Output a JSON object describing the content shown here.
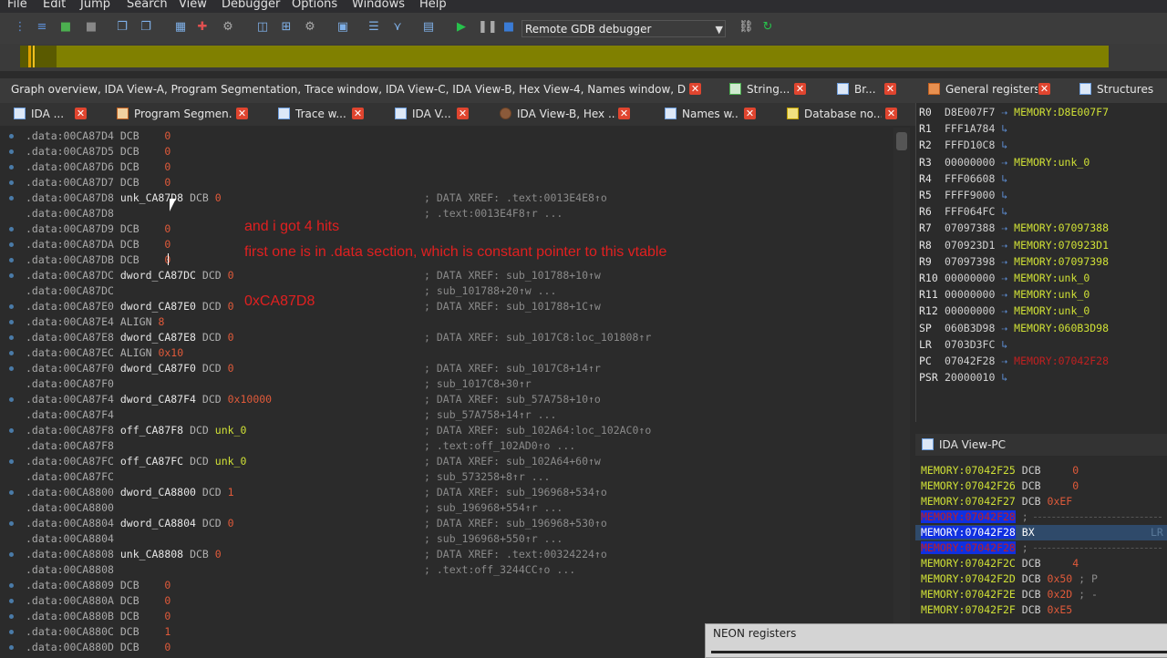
{
  "menu": [
    "File",
    "Edit",
    "Jump",
    "Search",
    "View",
    "Debugger",
    "Options",
    "Windows",
    "Help"
  ],
  "toolbar": {
    "debugger_select": "Remote GDB debugger"
  },
  "tabs_row1": {
    "group": "Graph overview, IDA View-A, Program Segmentation, Trace window, IDA View-C, IDA View-B, Hex View-4, Names window, Database...",
    "strings": "String...",
    "br": "Br...",
    "registers": "General registers",
    "structures": "Structures"
  },
  "tabs_row2": [
    "IDA ...",
    "Program Segmen...",
    "Trace w...",
    "IDA V...",
    "IDA View-B, Hex ...",
    "Names w...",
    "Database no..."
  ],
  "listing": [
    {
      "a": ".data:00CA87D4",
      "l": "",
      "k": "DCB",
      "v": "0",
      "c": ""
    },
    {
      "a": ".data:00CA87D5",
      "l": "",
      "k": "DCB",
      "v": "0",
      "c": ""
    },
    {
      "a": ".data:00CA87D6",
      "l": "",
      "k": "DCB",
      "v": "0",
      "c": ""
    },
    {
      "a": ".data:00CA87D7",
      "l": "",
      "k": "DCB",
      "v": "0",
      "c": ""
    },
    {
      "a": ".data:00CA87D8",
      "l": "unk_CA87D8",
      "k": "DCB",
      "v": "0",
      "c": "; DATA XREF: .text:0013E4E8↑o"
    },
    {
      "a": ".data:00CA87D8",
      "l": "",
      "k": "",
      "v": "",
      "c": "; .text:0013E4F8↑r ..."
    },
    {
      "a": ".data:00CA87D9",
      "l": "",
      "k": "DCB",
      "v": "0",
      "c": ""
    },
    {
      "a": ".data:00CA87DA",
      "l": "",
      "k": "DCB",
      "v": "0",
      "c": ""
    },
    {
      "a": ".data:00CA87DB",
      "l": "",
      "k": "DCB",
      "v": "0",
      "c": ""
    },
    {
      "a": ".data:00CA87DC",
      "l": "dword_CA87DC",
      "k": "DCD",
      "v": "0",
      "c": "; DATA XREF: sub_101788+10↑w"
    },
    {
      "a": ".data:00CA87DC",
      "l": "",
      "k": "",
      "v": "",
      "c": "; sub_101788+20↑w ..."
    },
    {
      "a": ".data:00CA87E0",
      "l": "dword_CA87E0",
      "k": "DCD",
      "v": "0",
      "c": "; DATA XREF: sub_101788+1C↑w"
    },
    {
      "a": ".data:00CA87E4",
      "l": "",
      "k": "ALIGN",
      "v": "8",
      "c": ""
    },
    {
      "a": ".data:00CA87E8",
      "l": "dword_CA87E8",
      "k": "DCD",
      "v": "0",
      "c": "; DATA XREF: sub_1017C8:loc_101808↑r"
    },
    {
      "a": ".data:00CA87EC",
      "l": "",
      "k": "ALIGN",
      "v": "0x10",
      "c": ""
    },
    {
      "a": ".data:00CA87F0",
      "l": "dword_CA87F0",
      "k": "DCD",
      "v": "0",
      "c": "; DATA XREF: sub_1017C8+14↑r"
    },
    {
      "a": ".data:00CA87F0",
      "l": "",
      "k": "",
      "v": "",
      "c": "; sub_1017C8+30↑r"
    },
    {
      "a": ".data:00CA87F4",
      "l": "dword_CA87F4",
      "k": "DCD",
      "v": "0x10000",
      "c": "; DATA XREF: sub_57A758+10↑o"
    },
    {
      "a": ".data:00CA87F4",
      "l": "",
      "k": "",
      "v": "",
      "c": "; sub_57A758+14↑r ..."
    },
    {
      "a": ".data:00CA87F8",
      "l": "off_CA87F8",
      "k": "DCD",
      "v": "unk_0",
      "c": "; DATA XREF: sub_102A64:loc_102AC0↑o"
    },
    {
      "a": ".data:00CA87F8",
      "l": "",
      "k": "",
      "v": "",
      "c": "; .text:off_102AD0↑o ..."
    },
    {
      "a": ".data:00CA87FC",
      "l": "off_CA87FC",
      "k": "DCD",
      "v": "unk_0",
      "c": "; DATA XREF: sub_102A64+60↑w"
    },
    {
      "a": ".data:00CA87FC",
      "l": "",
      "k": "",
      "v": "",
      "c": "; sub_573258+8↑r ..."
    },
    {
      "a": ".data:00CA8800",
      "l": "dword_CA8800",
      "k": "DCD",
      "v": "1",
      "c": "; DATA XREF: sub_196968+534↑o"
    },
    {
      "a": ".data:00CA8800",
      "l": "",
      "k": "",
      "v": "",
      "c": "; sub_196968+554↑r ..."
    },
    {
      "a": ".data:00CA8804",
      "l": "dword_CA8804",
      "k": "DCD",
      "v": "0",
      "c": "; DATA XREF: sub_196968+530↑o"
    },
    {
      "a": ".data:00CA8804",
      "l": "",
      "k": "",
      "v": "",
      "c": "; sub_196968+550↑r ..."
    },
    {
      "a": ".data:00CA8808",
      "l": "unk_CA8808",
      "k": "DCB",
      "v": "0",
      "c": "; DATA XREF: .text:00324224↑o"
    },
    {
      "a": ".data:00CA8808",
      "l": "",
      "k": "",
      "v": "",
      "c": "; .text:off_3244CC↑o ..."
    },
    {
      "a": ".data:00CA8809",
      "l": "",
      "k": "DCB",
      "v": "0",
      "c": ""
    },
    {
      "a": ".data:00CA880A",
      "l": "",
      "k": "DCB",
      "v": "0",
      "c": ""
    },
    {
      "a": ".data:00CA880B",
      "l": "",
      "k": "DCB",
      "v": "0",
      "c": ""
    },
    {
      "a": ".data:00CA880C",
      "l": "",
      "k": "DCB",
      "v": "1",
      "c": ""
    },
    {
      "a": ".data:00CA880D",
      "l": "",
      "k": "DCB",
      "v": "0",
      "c": ""
    }
  ],
  "annotations": {
    "line1": "and i got 4 hits",
    "line2": "first one is in .data section, which is constant pointer to this vtable",
    "line3": "0xCA87D8"
  },
  "registers": [
    {
      "n": "R0",
      "v": "D8E007F7",
      "m": "MEMORY:D8E007F7"
    },
    {
      "n": "R1",
      "v": "FFF1A784",
      "m": ""
    },
    {
      "n": "R2",
      "v": "FFFD10C8",
      "m": ""
    },
    {
      "n": "R3",
      "v": "00000000",
      "m": "MEMORY:unk_0"
    },
    {
      "n": "R4",
      "v": "FFF06608",
      "m": ""
    },
    {
      "n": "R5",
      "v": "FFFF9000",
      "m": ""
    },
    {
      "n": "R6",
      "v": "FFF064FC",
      "m": ""
    },
    {
      "n": "R7",
      "v": "07097388",
      "m": "MEMORY:07097388"
    },
    {
      "n": "R8",
      "v": "070923D1",
      "m": "MEMORY:070923D1"
    },
    {
      "n": "R9",
      "v": "07097398",
      "m": "MEMORY:07097398"
    },
    {
      "n": "R10",
      "v": "00000000",
      "m": "MEMORY:unk_0"
    },
    {
      "n": "R11",
      "v": "00000000",
      "m": "MEMORY:unk_0"
    },
    {
      "n": "R12",
      "v": "00000000",
      "m": "MEMORY:unk_0"
    },
    {
      "n": "SP",
      "v": "060B3D98",
      "m": "MEMORY:060B3D98"
    },
    {
      "n": "LR",
      "v": "0703D3FC",
      "m": ""
    },
    {
      "n": "PC",
      "v": "07042F28",
      "m": "MEMORY:07042F28"
    },
    {
      "n": "PSR",
      "v": "20000010",
      "m": ""
    }
  ],
  "pcview": {
    "title": "IDA View-PC",
    "lines": [
      {
        "a": "MEMORY:07042F25",
        "k": "DCB",
        "v": "0",
        "c": ""
      },
      {
        "a": "MEMORY:07042F26",
        "k": "DCB",
        "v": "0",
        "c": ""
      },
      {
        "a": "MEMORY:07042F27",
        "k": "DCB",
        "v": "0xEF",
        "c": ""
      },
      {
        "a": "MEMORY:07042F28",
        "k": "",
        "v": "",
        "c": ";"
      },
      {
        "a": "MEMORY:07042F28",
        "k": "BX",
        "v": "",
        "c": "LR"
      },
      {
        "a": "MEMORY:07042F28",
        "k": "",
        "v": "",
        "c": ";"
      },
      {
        "a": "MEMORY:07042F2C",
        "k": "DCB",
        "v": "4",
        "c": ""
      },
      {
        "a": "MEMORY:07042F2D",
        "k": "DCB",
        "v": "0x50",
        "c": "; P"
      },
      {
        "a": "MEMORY:07042F2E",
        "k": "DCB",
        "v": "0x2D",
        "c": "; -"
      },
      {
        "a": "MEMORY:07042F2F",
        "k": "DCB",
        "v": "0xE5",
        "c": ""
      }
    ]
  },
  "neon": {
    "title": "NEON registers"
  }
}
